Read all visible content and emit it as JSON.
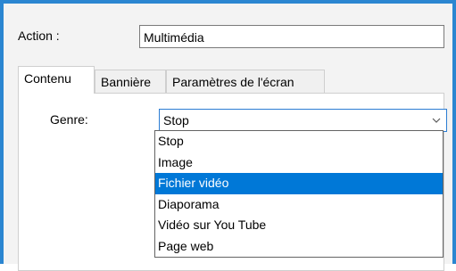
{
  "action": {
    "label": "Action :",
    "value": "Multimédia"
  },
  "tabs": [
    {
      "label": "Contenu"
    },
    {
      "label": "Bannière"
    },
    {
      "label": "Paramètres de l'écran"
    }
  ],
  "content": {
    "genre_label": "Genre:",
    "genre_selected": "Stop",
    "options": [
      "Stop",
      "Image",
      "Fichier vidéo",
      "Diaporama",
      "Vidéo sur You Tube",
      "Page web"
    ],
    "highlighted_option": "Fichier vidéo"
  },
  "colors": {
    "accent": "#2b86d1",
    "selection": "#0078d7"
  }
}
